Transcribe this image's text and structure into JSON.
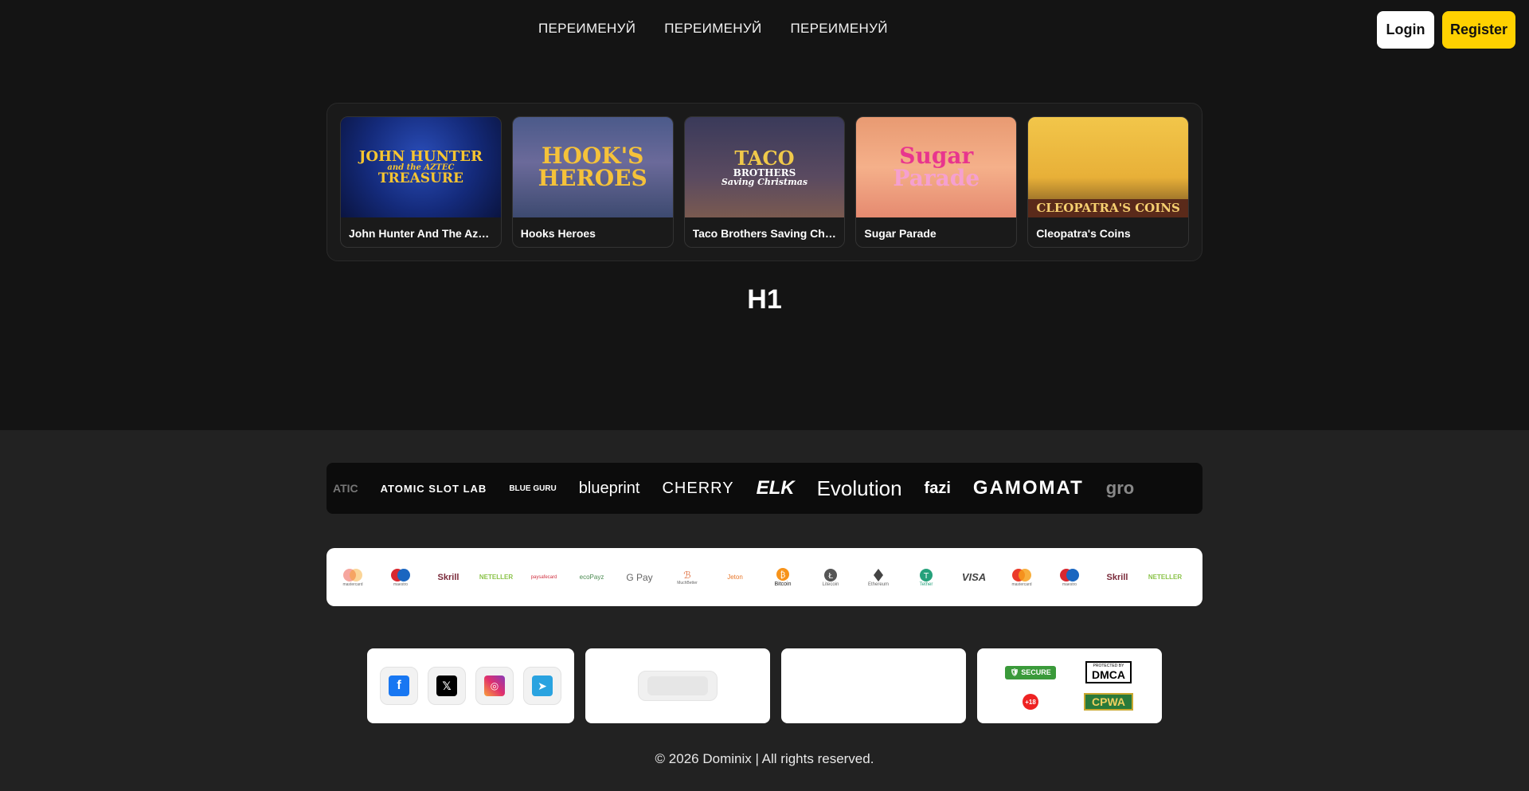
{
  "header": {
    "nav": [
      "ПЕРЕИМЕНУЙ",
      "ПЕРЕИМЕНУЙ",
      "ПЕРЕИМЕНУЙ"
    ],
    "login_label": "Login",
    "register_label": "Register"
  },
  "games": [
    {
      "title": "John Hunter And The Aztec Treasure",
      "art": [
        "JOHN HUNTER",
        "and the AZTEC",
        "TREASURE"
      ]
    },
    {
      "title": "Hooks Heroes",
      "art": [
        "HOOK'S",
        "HEROES"
      ]
    },
    {
      "title": "Taco Brothers Saving Christmas",
      "art": [
        "TACO",
        "BROTHERS",
        "Saving Christmas"
      ]
    },
    {
      "title": "Sugar Parade",
      "art": [
        "Sugar",
        "Parade"
      ]
    },
    {
      "title": "Cleopatra's Coins",
      "art": [
        "CLEOPATRA'S COINS"
      ]
    }
  ],
  "heading": "H1",
  "providers": [
    "ATIC",
    "ATOMIC SLOT LAB",
    "BLUE GURU",
    "blueprint",
    "CHERRY",
    "ELK",
    "Evolution",
    "fazi",
    "GAMOMAT",
    "gro"
  ],
  "payments": [
    "mastercard",
    "maestro",
    "Skrill",
    "NETELLER",
    "paysafecard",
    "ecoPayz",
    "G Pay",
    "MuchBetter",
    "Jeton",
    "Bitcoin",
    "Litecoin",
    "Ethereum",
    "Tether",
    "VISA",
    "mastercard",
    "maestro",
    "Skrill",
    "NETELLER"
  ],
  "badges": {
    "secure": "SECURE",
    "dmca": "DMCA",
    "dmca_top": "PROTECTED BY",
    "age": "+18",
    "cpwa": "CPWA"
  },
  "copyright": "© 2026 Dominix | All rights reserved.",
  "colors": {
    "accent": "#ffd100",
    "background": "#141414",
    "footer": "#222222"
  }
}
